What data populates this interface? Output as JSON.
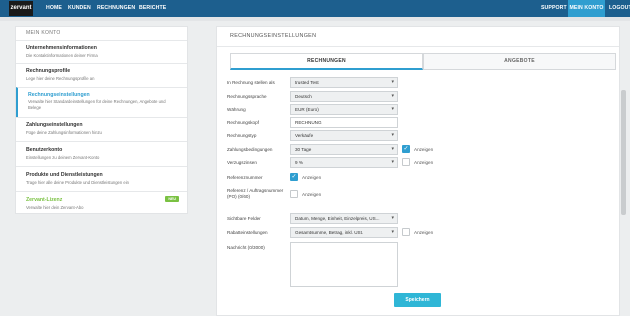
{
  "brand": {
    "logo_text": "zervant"
  },
  "topnav": {
    "left": [
      "HOME",
      "KUNDEN",
      "RECHNUNGEN",
      "BERICHTE"
    ],
    "support": "SUPPORT",
    "account": "MEIN KONTO",
    "logout": "LOGOUT"
  },
  "sidebar": {
    "header": "MEIN KONTO",
    "items": [
      {
        "title": "Unternehmensinformationen",
        "desc": "Die Kontaktinformationen deiner Firma"
      },
      {
        "title": "Rechnungsprofile",
        "desc": "Lege hier deine Rechnungsprofile an"
      },
      {
        "title": "Rechnungseinstellungen",
        "desc": "Verwalte hier Standardeinstellungen für deine Rechnungen, Angebote und Belege"
      },
      {
        "title": "Zahlungseinstellungen",
        "desc": "Füge deine Zahlungsinformationen hinzu"
      },
      {
        "title": "Benutzerkonto",
        "desc": "Einstellungen zu deinem Zervant-Konto"
      },
      {
        "title": "Produkte und Dienstleistungen",
        "desc": "Trage hier alle deine Produkte und Dienstleistungen ein"
      },
      {
        "title": "Zervant-Lizenz",
        "desc": "Verwalte hier dein Zervant-Abo",
        "badge": "NEU"
      }
    ]
  },
  "panel": {
    "title": "RECHNUNGSEINSTELLUNGEN",
    "tabs": [
      "RECHNUNGEN",
      "ANGEBOTE"
    ],
    "fields": {
      "status_label": "In Rechnung stellen als",
      "status_value": "trusted Test",
      "language_label": "Rechnungssprache",
      "language_value": "Deutsch",
      "currency_label": "Währung",
      "currency_value": "EUR (Euro)",
      "header_label": "Rechnungskopf",
      "header_value": "RECHNUNG",
      "type_label": "Rechnungstyp",
      "type_value": "Verkäufe",
      "payment_terms_label": "Zahlungsbedingungen",
      "payment_terms_value": "30 Tage",
      "interest_label": "Verzugszinsen",
      "interest_value": "9 %",
      "ref_label": "Referenznummer",
      "po_label": "Referenz / Auftragsnummer (PO) (0/60)",
      "visible_fields_label": "Sichtbare Felder",
      "visible_fields_value": "Datum, Menge, Einheit, Einzelpreis, US...",
      "discount_label": "Rabatteinstellungen",
      "discount_value": "Gesamtsumme, Betrag, inkl. USt.",
      "message_label": "Nachricht (0/3000)",
      "show_label": "Anzeigen"
    },
    "save_label": "Speichern"
  },
  "colors": {
    "primary": "#1d5f8e",
    "accent": "#2f9ed0",
    "save": "#2fb6d6",
    "new_badge": "#7ac142"
  }
}
